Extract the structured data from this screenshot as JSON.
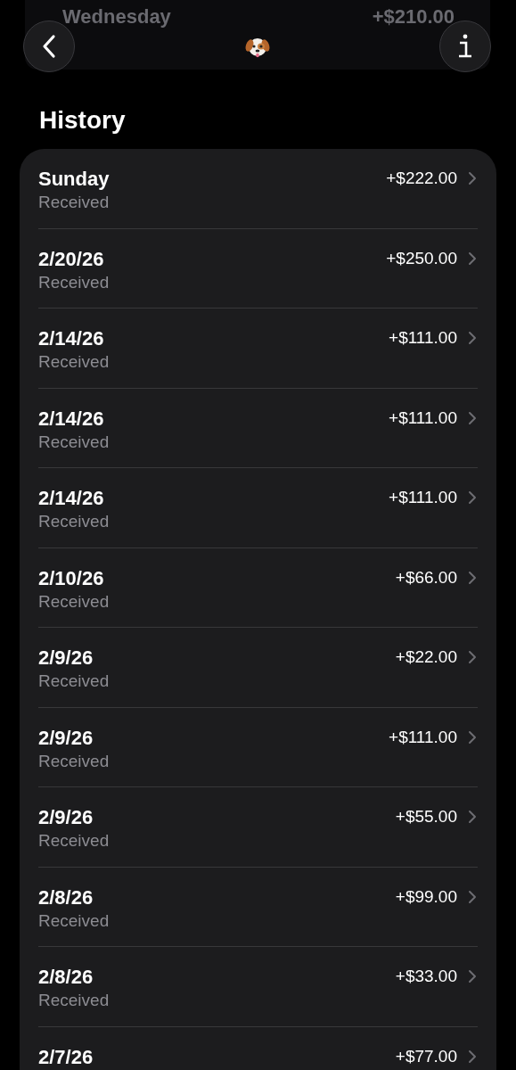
{
  "behind_header": {
    "title": "Wednesday",
    "amount": "+$210.00"
  },
  "heading": "History",
  "transactions": [
    {
      "date": "Sunday",
      "status": "Received",
      "amount": "+$222.00"
    },
    {
      "date": "2/20/26",
      "status": "Received",
      "amount": "+$250.00"
    },
    {
      "date": "2/14/26",
      "status": "Received",
      "amount": "+$111.00"
    },
    {
      "date": "2/14/26",
      "status": "Received",
      "amount": "+$111.00"
    },
    {
      "date": "2/14/26",
      "status": "Received",
      "amount": "+$111.00"
    },
    {
      "date": "2/10/26",
      "status": "Received",
      "amount": "+$66.00"
    },
    {
      "date": "2/9/26",
      "status": "Received",
      "amount": "+$22.00"
    },
    {
      "date": "2/9/26",
      "status": "Received",
      "amount": "+$111.00"
    },
    {
      "date": "2/9/26",
      "status": "Received",
      "amount": "+$55.00"
    },
    {
      "date": "2/8/26",
      "status": "Received",
      "amount": "+$99.00"
    },
    {
      "date": "2/8/26",
      "status": "Received",
      "amount": "+$33.00"
    },
    {
      "date": "2/7/26",
      "amount": "+$77.00"
    }
  ]
}
